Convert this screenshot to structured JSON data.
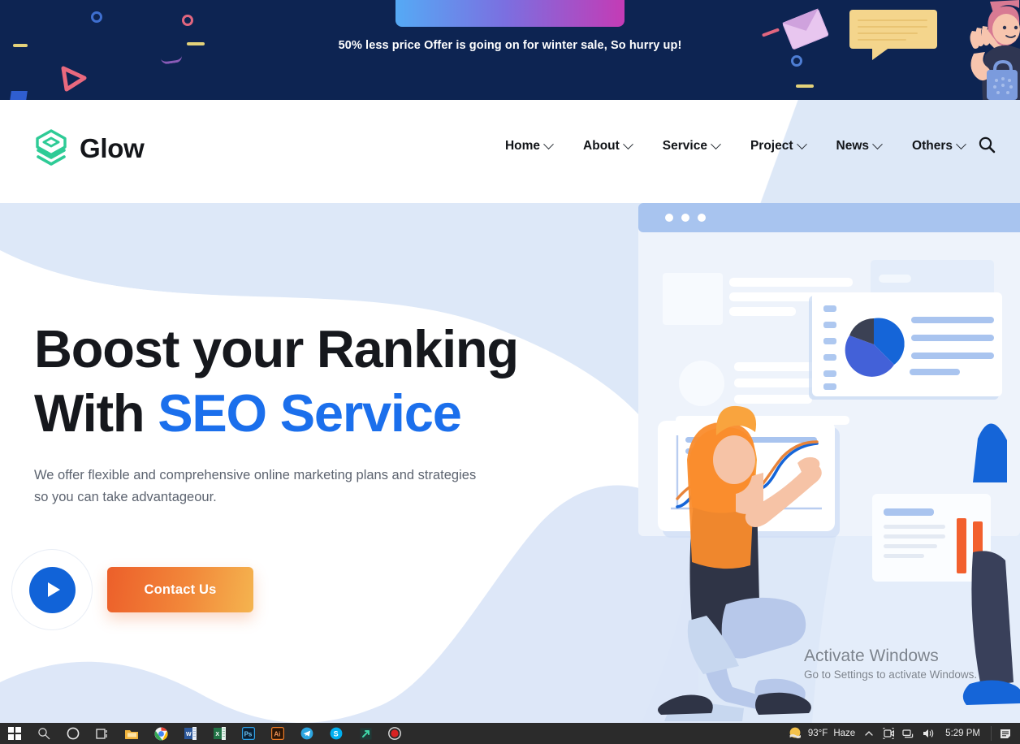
{
  "promo": {
    "text": "50% less price Offer is going on for winter sale, So hurry up!",
    "bg_color": "#0d2452",
    "gradient_from": "#55aaf5",
    "gradient_to": "#c43bb5"
  },
  "header": {
    "brand": "Glow",
    "brand_logo_color": "#2ecb96",
    "nav": [
      {
        "label": "Home"
      },
      {
        "label": "About"
      },
      {
        "label": "Service"
      },
      {
        "label": "Project"
      },
      {
        "label": "News"
      },
      {
        "label": "Others"
      }
    ],
    "search_icon": "search-icon"
  },
  "hero": {
    "title_line1": "Boost your Ranking",
    "title_line2_plain": "With ",
    "title_line2_accent": "SEO Service",
    "accent_color": "#1b6fec",
    "subtitle": "We offer flexible and comprehensive online marketing plans and strategies so you can take advantageour.",
    "play_label": "play-button",
    "cta_label": "Contact Us",
    "cta_gradient_from": "#ec5f2a",
    "cta_gradient_to": "#f4b44f"
  },
  "illustration": {
    "browser_dots": 3,
    "pie_chart": {
      "type": "pie",
      "values": [
        42,
        30,
        28
      ],
      "colors": [
        "#1565d8",
        "#3b4154",
        "#4361d8"
      ],
      "title": ""
    },
    "line_chart": {
      "type": "line",
      "series": [
        {
          "name": "blue",
          "color": "#1565d8",
          "values": [
            2,
            18,
            40,
            44,
            38,
            34,
            44,
            68,
            76,
            78
          ]
        },
        {
          "name": "orange",
          "color": "#e8693a",
          "values": [
            10,
            26,
            38,
            34,
            28,
            26,
            36,
            62,
            76,
            78
          ]
        }
      ],
      "x": [
        0,
        1,
        2,
        3,
        4,
        5,
        6,
        7,
        8,
        9
      ],
      "ylim": [
        0,
        90
      ],
      "grid": false
    },
    "bars": {
      "type": "bar",
      "values": [
        64,
        58
      ],
      "color": "#f2602e"
    }
  },
  "watermark": {
    "title": "Activate Windows",
    "subtitle": "Go to Settings to activate Windows."
  },
  "taskbar": {
    "items": [
      {
        "name": "start-button",
        "icon": "windows-icon"
      },
      {
        "name": "search-button",
        "icon": "search-icon"
      },
      {
        "name": "cortana-button",
        "icon": "circle-icon"
      },
      {
        "name": "task-view-button",
        "icon": "task-view-icon"
      },
      {
        "name": "file-explorer",
        "icon": "folder-icon"
      },
      {
        "name": "google-chrome",
        "icon": "chrome-icon"
      },
      {
        "name": "microsoft-word",
        "icon": "word-icon"
      },
      {
        "name": "microsoft-excel",
        "icon": "excel-icon"
      },
      {
        "name": "adobe-photoshop",
        "icon": "photoshop-icon"
      },
      {
        "name": "adobe-illustrator",
        "icon": "illustrator-icon"
      },
      {
        "name": "telegram",
        "icon": "telegram-icon"
      },
      {
        "name": "skype",
        "icon": "skype-icon"
      },
      {
        "name": "teamviewer",
        "icon": "arrow-icon"
      },
      {
        "name": "screen-recorder",
        "icon": "record-icon"
      }
    ],
    "weather": {
      "temperature": "93°F",
      "condition": "Haze"
    },
    "tray": [
      "show-hidden-icons",
      "camera-icon",
      "network-icon",
      "volume-icon"
    ],
    "clock": "5:29 PM",
    "notifications": "notification-icon"
  }
}
